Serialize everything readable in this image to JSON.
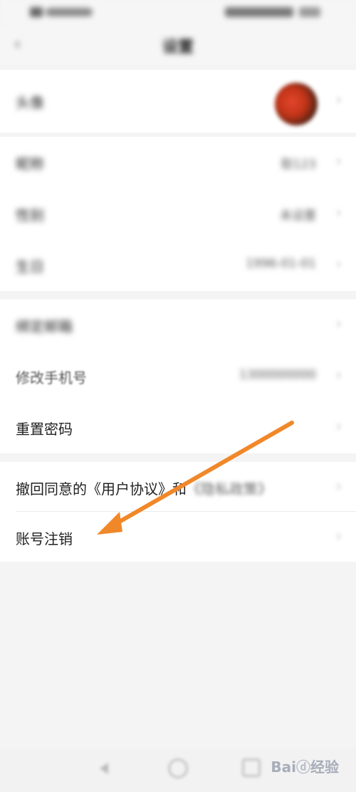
{
  "nav": {
    "back_icon": "chevron-left-icon",
    "title": "设置"
  },
  "profile": {
    "avatar_label": "头像"
  },
  "info_rows": [
    {
      "label": "昵称",
      "value": "取123"
    },
    {
      "label": "性别",
      "value": "未设置"
    },
    {
      "label": "生日",
      "value": "1996-01-01"
    }
  ],
  "account_rows": [
    {
      "label": "绑定邮箱",
      "value": ""
    },
    {
      "label": "修改手机号",
      "value": "1300000000"
    },
    {
      "label": "重置密码",
      "value": ""
    }
  ],
  "agreement_row": {
    "label": "撤回同意的《用户协议》和",
    "label_blurred": "《隐私政策》"
  },
  "delete_row": {
    "label": "账号注销"
  },
  "chevron": "›",
  "watermark": {
    "text": "Bai",
    "paw": "ⓓ",
    "suffix": "经验"
  },
  "annotation": {
    "arrow_color": "#f0882a"
  }
}
